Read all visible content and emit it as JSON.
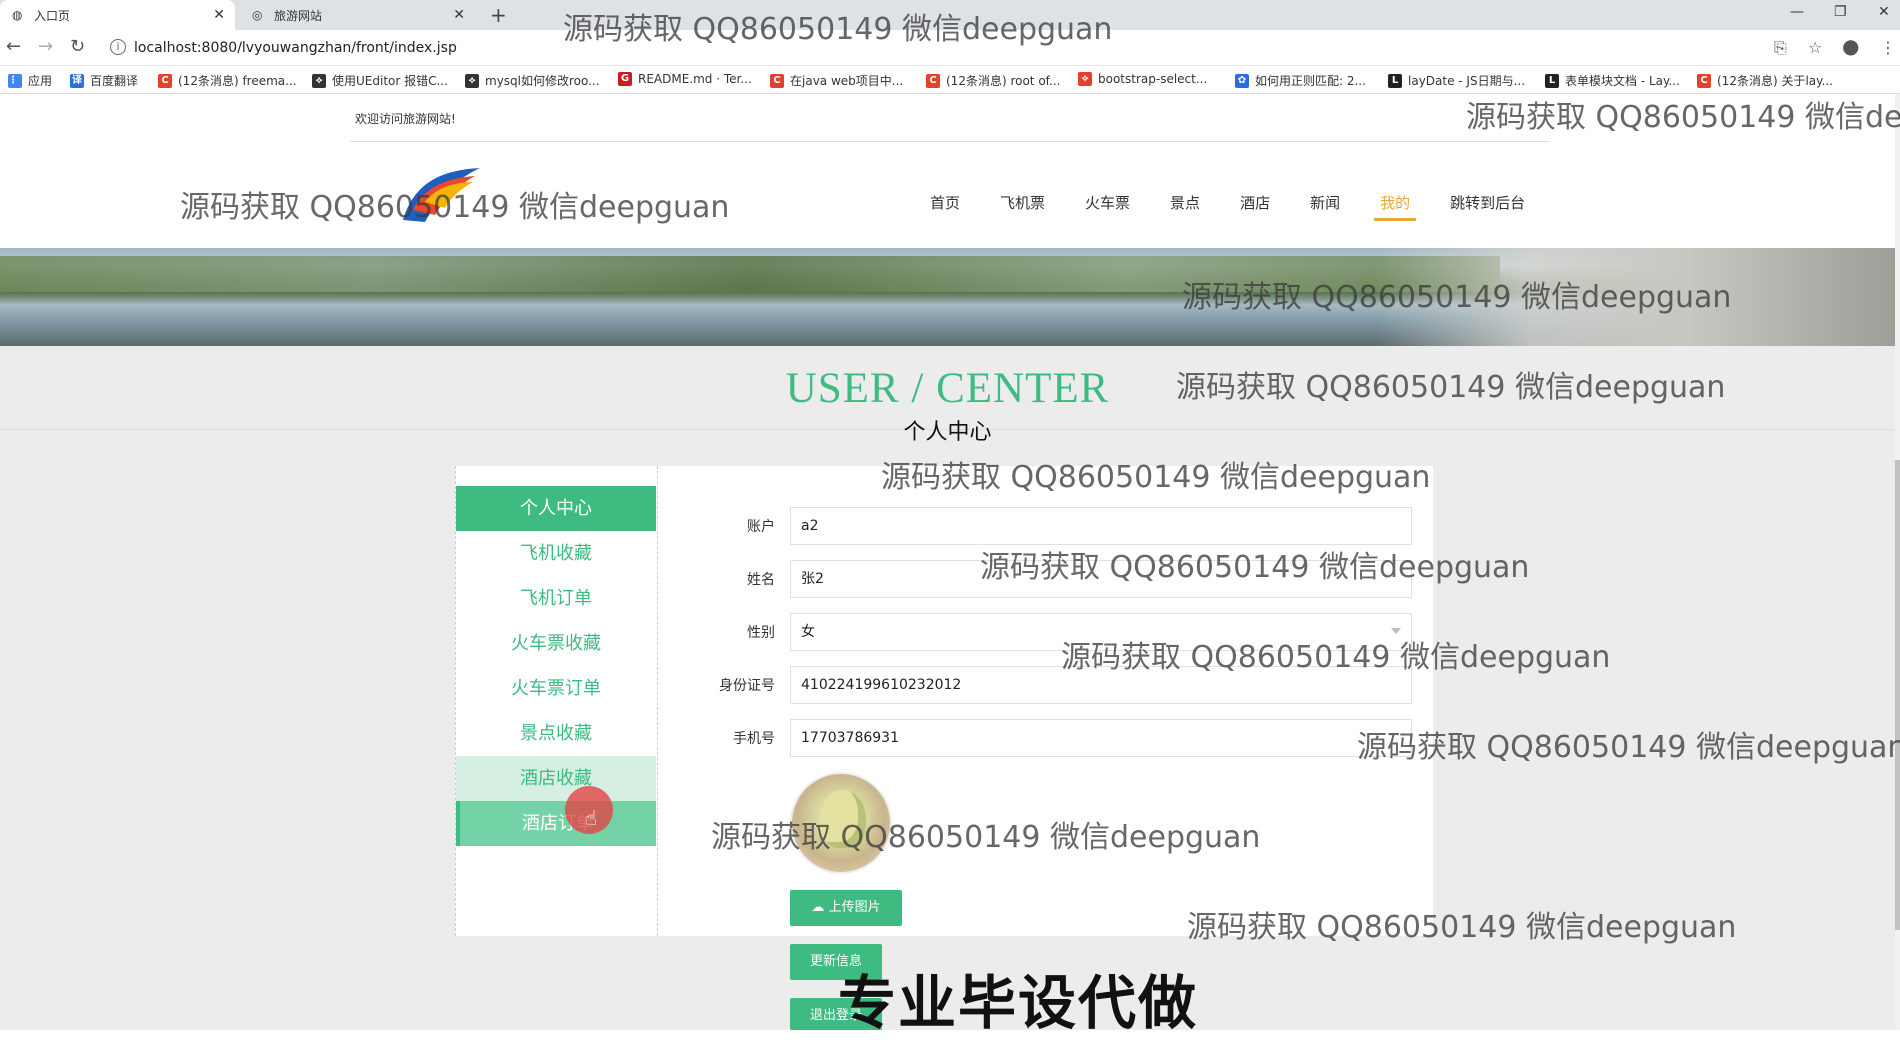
{
  "browser": {
    "tabs": [
      {
        "label": "入口页",
        "active": true
      },
      {
        "label": "旅游网站",
        "active": false
      }
    ],
    "url": "localhost:8080/lvyouwangzhan/front/index.jsp",
    "bookmarks": [
      {
        "label": "应用",
        "icon": "apps-grid-icon",
        "color": "#4285f4"
      },
      {
        "label": "百度翻译",
        "icon": "translate-icon",
        "color": "#2d6cdf"
      },
      {
        "label": "(12条消息) freema...",
        "icon": "csdn-icon",
        "color": "#e2412b"
      },
      {
        "label": "使用UEditor 报错C...",
        "icon": "page-icon",
        "color": "#333333"
      },
      {
        "label": "mysql如何修改roo...",
        "icon": "page-icon",
        "color": "#333333"
      },
      {
        "label": "README.md · Ter...",
        "icon": "gitee-icon",
        "color": "#c71d23"
      },
      {
        "label": "在java web项目中...",
        "icon": "csdn-icon",
        "color": "#e2412b"
      },
      {
        "label": "(12条消息) root of...",
        "icon": "csdn-icon",
        "color": "#e2412b"
      },
      {
        "label": "bootstrap-select...",
        "icon": "page-icon",
        "color": "#e2412b"
      },
      {
        "label": "如何用正则匹配: 2...",
        "icon": "baidu-icon",
        "color": "#2d6cdf"
      },
      {
        "label": "layDate - JS日期与...",
        "icon": "layui-icon",
        "color": "#222222"
      },
      {
        "label": "表单模块文档 - Lay...",
        "icon": "layui-icon",
        "color": "#222222"
      },
      {
        "label": "(12条消息) 关于lay...",
        "icon": "csdn-icon",
        "color": "#e2412b"
      }
    ]
  },
  "header": {
    "welcome": "欢迎访问旅游网站!",
    "nav": [
      {
        "label": "首页",
        "active": false
      },
      {
        "label": "飞机票",
        "active": false
      },
      {
        "label": "火车票",
        "active": false
      },
      {
        "label": "景点",
        "active": false
      },
      {
        "label": "酒店",
        "active": false
      },
      {
        "label": "新闻",
        "active": false
      },
      {
        "label": "我的",
        "active": true
      },
      {
        "label": "跳转到后台",
        "active": false
      }
    ]
  },
  "section": {
    "title_en": "USER / CENTER",
    "title_cn": "个人中心"
  },
  "sidebar": {
    "items": [
      {
        "label": "个人中心",
        "state": "active"
      },
      {
        "label": "飞机收藏",
        "state": "normal"
      },
      {
        "label": "飞机订单",
        "state": "normal"
      },
      {
        "label": "火车票收藏",
        "state": "normal"
      },
      {
        "label": "火车票订单",
        "state": "normal"
      },
      {
        "label": "景点收藏",
        "state": "normal"
      },
      {
        "label": "酒店收藏",
        "state": "hover"
      },
      {
        "label": "酒店订单",
        "state": "selected"
      }
    ]
  },
  "form": {
    "fields": [
      {
        "label": "账户",
        "value": "a2",
        "type": "text"
      },
      {
        "label": "姓名",
        "value": "张2",
        "type": "text"
      },
      {
        "label": "性别",
        "value": "女",
        "type": "select"
      },
      {
        "label": "身份证号",
        "value": "410224199610232012",
        "type": "text"
      },
      {
        "label": "手机号",
        "value": "17703786931",
        "type": "text"
      }
    ],
    "upload_label": "上传图片",
    "update_label": "更新信息",
    "logout_label": "退出登录"
  },
  "overlay": {
    "watermark": "源码获取 QQ86050149 微信deepguan",
    "caption": "专业毕设代做"
  },
  "colors": {
    "accent": "#3dbb80",
    "nav_active": "#e8a73a"
  }
}
